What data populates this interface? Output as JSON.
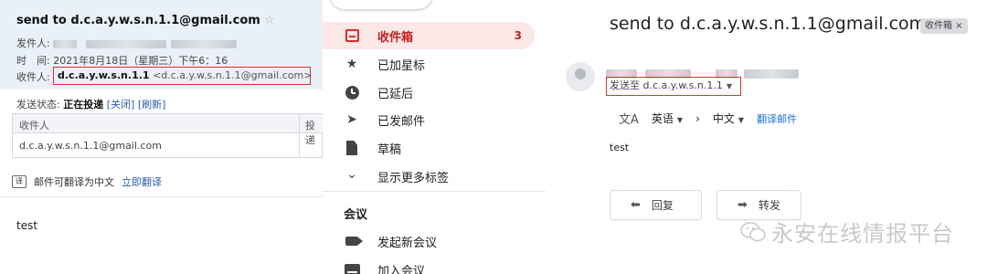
{
  "left_panel": {
    "subject": "send to d.c.a.y.w.s.n.1.1@gmail.com",
    "star": "☆",
    "from_label": "发件人:",
    "time_label": "时　间:",
    "time_value": "2021年8月18日（星期三）下午6：16",
    "to_label": "收件人:",
    "to_name": "d.c.a.y.w.s.n.1.1",
    "to_address": "<d.c.a.y.w.s.n.1.1@gmail.com>",
    "status_label": "发送状态:",
    "status_value": "正在投递",
    "status_close": "[关闭]",
    "status_refresh": "[刷新]",
    "table_headers": [
      "收件人",
      "投递"
    ],
    "table_rows": [
      [
        "d.c.a.y.w.s.n.1.1@gmail.com",
        ""
      ]
    ],
    "translate_icon": "译",
    "translate_text": "邮件可翻译为中文",
    "translate_link": "立即翻译",
    "body": "test"
  },
  "mid_panel": {
    "nav_items": [
      {
        "label": "收件箱",
        "icon": "inbox-icon",
        "count": "3",
        "active": true
      },
      {
        "label": "已加星标",
        "icon": "star-icon",
        "glyph": "★"
      },
      {
        "label": "已延后",
        "icon": "clock-icon"
      },
      {
        "label": "已发邮件",
        "icon": "send-icon",
        "glyph": "➤"
      },
      {
        "label": "草稿",
        "icon": "draft-icon"
      },
      {
        "label": "显示更多标签",
        "icon": "chevron-down-icon",
        "glyph": "⌄"
      }
    ],
    "meet_title": "会议",
    "meet_items": [
      {
        "label": "发起新会议",
        "icon": "video-camera-icon"
      },
      {
        "label": "加入会议",
        "icon": "keyboard-icon"
      }
    ]
  },
  "right_panel": {
    "subject": "send to d.c.a.y.w.s.n.1.1@gmail.com",
    "label_chip": "收件箱 ×",
    "send_to": "发送至 d.c.a.y.w.s.n.1.1",
    "send_to_caret": "▼",
    "translate_icon": "文A",
    "translate_from": "英语",
    "translate_arrow": "›",
    "translate_to": "中文",
    "translate_caret": "▼",
    "translate_link": "翻译邮件",
    "body": "test",
    "reply_icon": "⬅",
    "reply_label": "回复",
    "forward_icon": "➡",
    "forward_label": "转发",
    "watermark": "永安在线情报平台"
  },
  "colors": {
    "accent_red": "#d93025",
    "annotation_red": "#e03030",
    "link_blue": "#1a73e8",
    "header_bg": "#eaf0f7"
  }
}
